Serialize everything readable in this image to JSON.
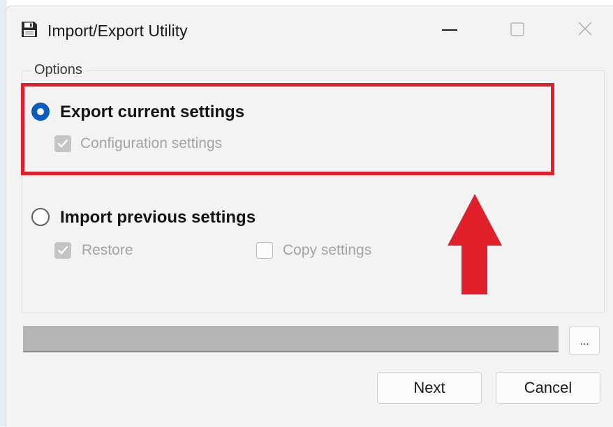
{
  "window": {
    "title": "Import/Export Utility",
    "icons": {
      "app": "floppy-disk-icon",
      "minimize": "minimize-icon",
      "maximize": "maximize-icon",
      "close": "close-icon"
    }
  },
  "options": {
    "group_label": "Options",
    "export": {
      "label": "Export current settings",
      "selected": true,
      "configuration": {
        "label": "Configuration settings",
        "checked": true,
        "enabled": false
      }
    },
    "import": {
      "label": "Import previous settings",
      "selected": false,
      "restore": {
        "label": "Restore",
        "checked": true,
        "enabled": false
      },
      "copy": {
        "label": "Copy settings",
        "checked": false,
        "enabled": false
      }
    }
  },
  "path": {
    "value": "",
    "browse_label": "..."
  },
  "buttons": {
    "next": "Next",
    "cancel": "Cancel"
  },
  "annotation": {
    "color": "#e0202a",
    "shapes": [
      "highlight-box",
      "up-arrow"
    ]
  },
  "colors": {
    "accent": "#0b5cbf",
    "background": "#f3f3f3"
  }
}
